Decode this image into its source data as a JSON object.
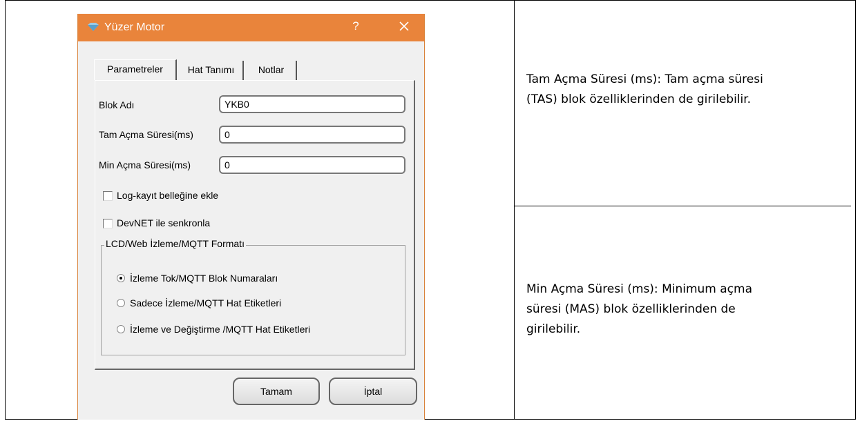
{
  "dialog": {
    "title": "Yüzer Motor",
    "help_label": "?",
    "tabs": [
      {
        "label": "Parametreler",
        "active": true
      },
      {
        "label": "Hat Tanımı",
        "active": false
      },
      {
        "label": "Notlar",
        "active": false
      }
    ],
    "fields": {
      "block_name": {
        "label": "Blok Adı",
        "value": "YKB0"
      },
      "full_open_time": {
        "label": "Tam Açma Süresi(ms)",
        "value": "0"
      },
      "min_open_time": {
        "label": "Min Açma Süresi(ms)",
        "value": "0"
      }
    },
    "checkboxes": [
      {
        "label": "Log-kayıt belleğine ekle",
        "checked": false
      },
      {
        "label": "DevNET ile senkronla",
        "checked": false
      }
    ],
    "group": {
      "title": "LCD/Web İzleme/MQTT Formatı",
      "options": [
        {
          "label": "İzleme Tok/MQTT Blok Numaraları",
          "selected": true
        },
        {
          "label": "Sadece İzleme/MQTT Hat Etiketleri",
          "selected": false
        },
        {
          "label": "İzleme ve Değiştirme /MQTT Hat Etiketleri",
          "selected": false
        }
      ]
    },
    "buttons": {
      "ok": "Tamam",
      "cancel": "İptal"
    },
    "colors": {
      "titlebar": "#e9843b"
    }
  },
  "descriptions": {
    "full_open": {
      "line1": "Tam Açma Süresi (ms):  Tam açma süresi",
      "line2": "(TAS) blok özelliklerinden de girilebilir."
    },
    "min_open": {
      "line1": "Min Açma Süresi (ms):  Minimum açma",
      "line2": "süresi (MAS) blok özelliklerinden de",
      "line3": "girilebilir."
    }
  }
}
